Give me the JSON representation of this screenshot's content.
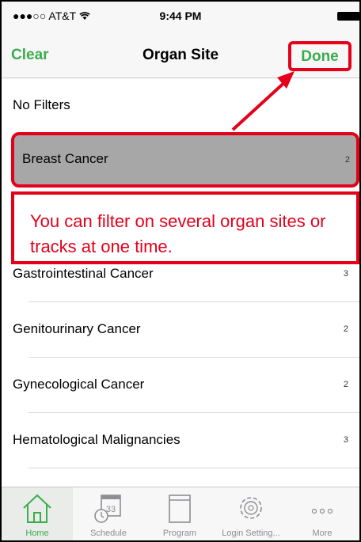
{
  "status_bar": {
    "signal": "●●●○○",
    "carrier": "AT&T",
    "wifi": "wifi-icon",
    "time": "9:44 PM"
  },
  "nav": {
    "clear_label": "Clear",
    "title": "Organ Site",
    "done_label": "Done"
  },
  "list": {
    "no_filters": "No Filters",
    "items": [
      {
        "label": "Breast Cancer",
        "count": "2",
        "selected": true
      },
      {
        "label": "Gastrointestinal Cancer",
        "count": "3"
      },
      {
        "label": "Genitourinary Cancer",
        "count": "2"
      },
      {
        "label": "Gynecological Cancer",
        "count": "2"
      },
      {
        "label": "Hematological Malignancies",
        "count": "3"
      }
    ]
  },
  "annotation": {
    "text": "You can filter on several organ sites or tracks at one time.",
    "color": "#e4001b"
  },
  "tabs": [
    {
      "label": "Home",
      "icon": "home-icon",
      "active": true
    },
    {
      "label": "Schedule",
      "icon": "calendar-clock-icon"
    },
    {
      "label": "Program",
      "icon": "book-icon"
    },
    {
      "label": "Login Setting...",
      "icon": "gear-icon"
    },
    {
      "label": "More",
      "icon": "more-dots-icon"
    }
  ],
  "colors": {
    "accent": "#3aad4d",
    "annotation": "#e4001b",
    "selected_row": "#a7a7a7"
  }
}
